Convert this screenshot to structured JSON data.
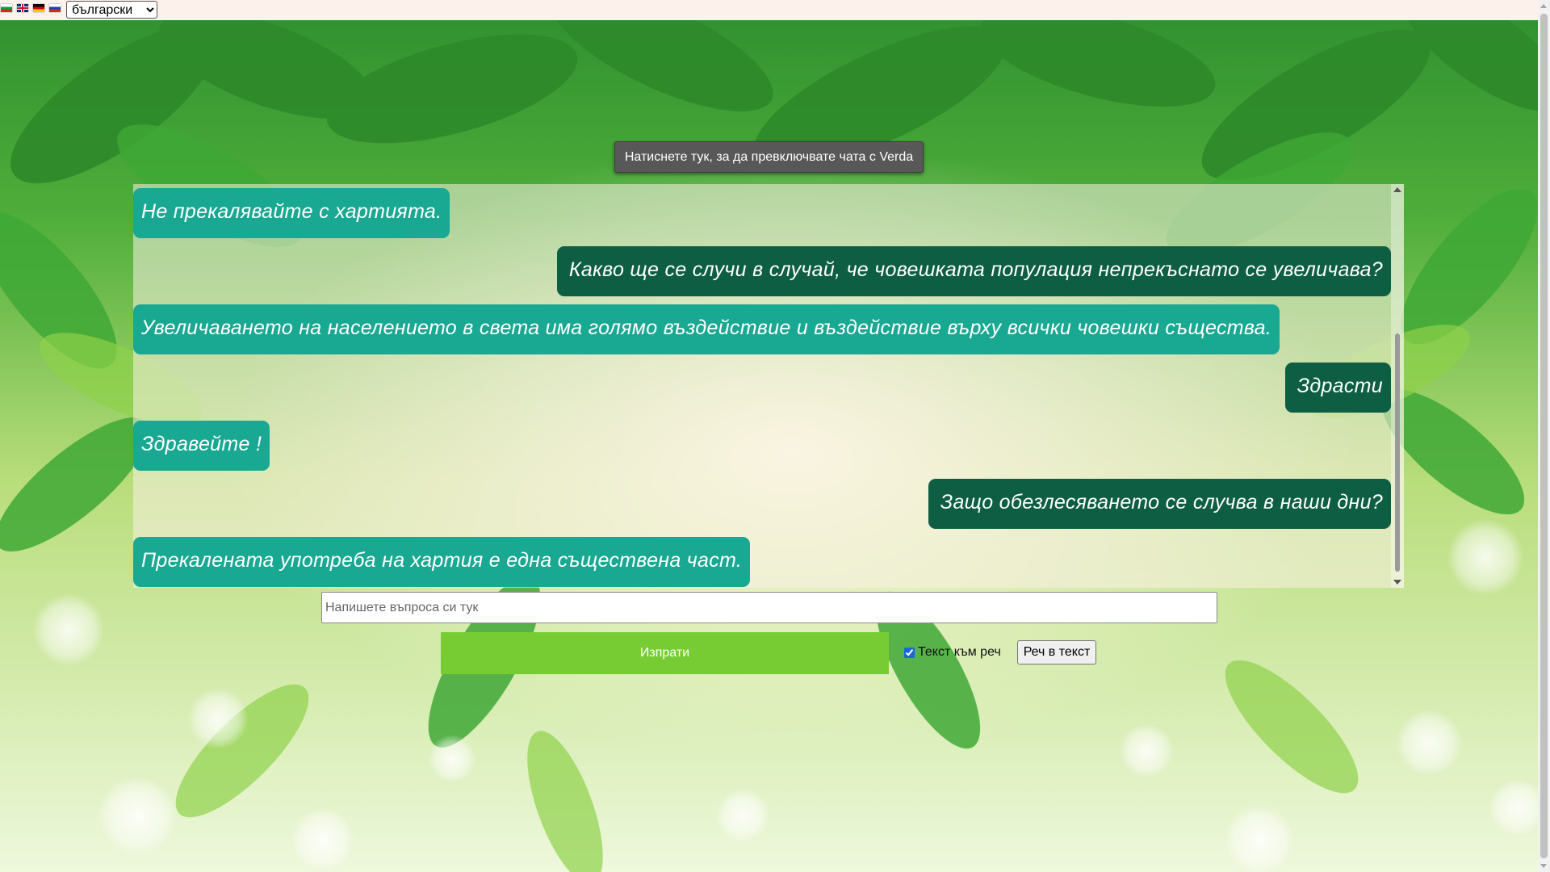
{
  "language_bar": {
    "flags": [
      "bulgarian-flag-icon",
      "english-flag-icon",
      "german-flag-icon",
      "russian-flag-icon"
    ],
    "selected_language": "български"
  },
  "toggle_button_label": "Натиснете тук, за да превключвате чата с Verda",
  "chat": {
    "messages": [
      {
        "role": "bot",
        "text": "Не прекалявайте с хартията."
      },
      {
        "role": "user",
        "text": "Какво ще се случи в случай, че човешката популация непрекъснато се увеличава?"
      },
      {
        "role": "bot",
        "text": "Увеличаването на населението в света има голямо въздействие и въздействие върху всички човешки същества."
      },
      {
        "role": "user",
        "text": "Здрасти"
      },
      {
        "role": "bot",
        "text": "Здравейте !"
      },
      {
        "role": "user",
        "text": "Защо обезлесяването се случва в наши дни?"
      },
      {
        "role": "bot",
        "text": "Прекалената употреба на хартия е една съществена част."
      }
    ]
  },
  "input": {
    "placeholder": "Напишете въпроса си тук",
    "value": ""
  },
  "send_button_label": "Изпрати",
  "tts": {
    "label": "Текст към реч",
    "checked": true
  },
  "stt_button_label": "Реч в текст",
  "colors": {
    "bot_bubble": "#19a892",
    "user_bubble": "#0e5e44",
    "send_button": "#77cc33",
    "top_bar": "#fdf1ec"
  }
}
